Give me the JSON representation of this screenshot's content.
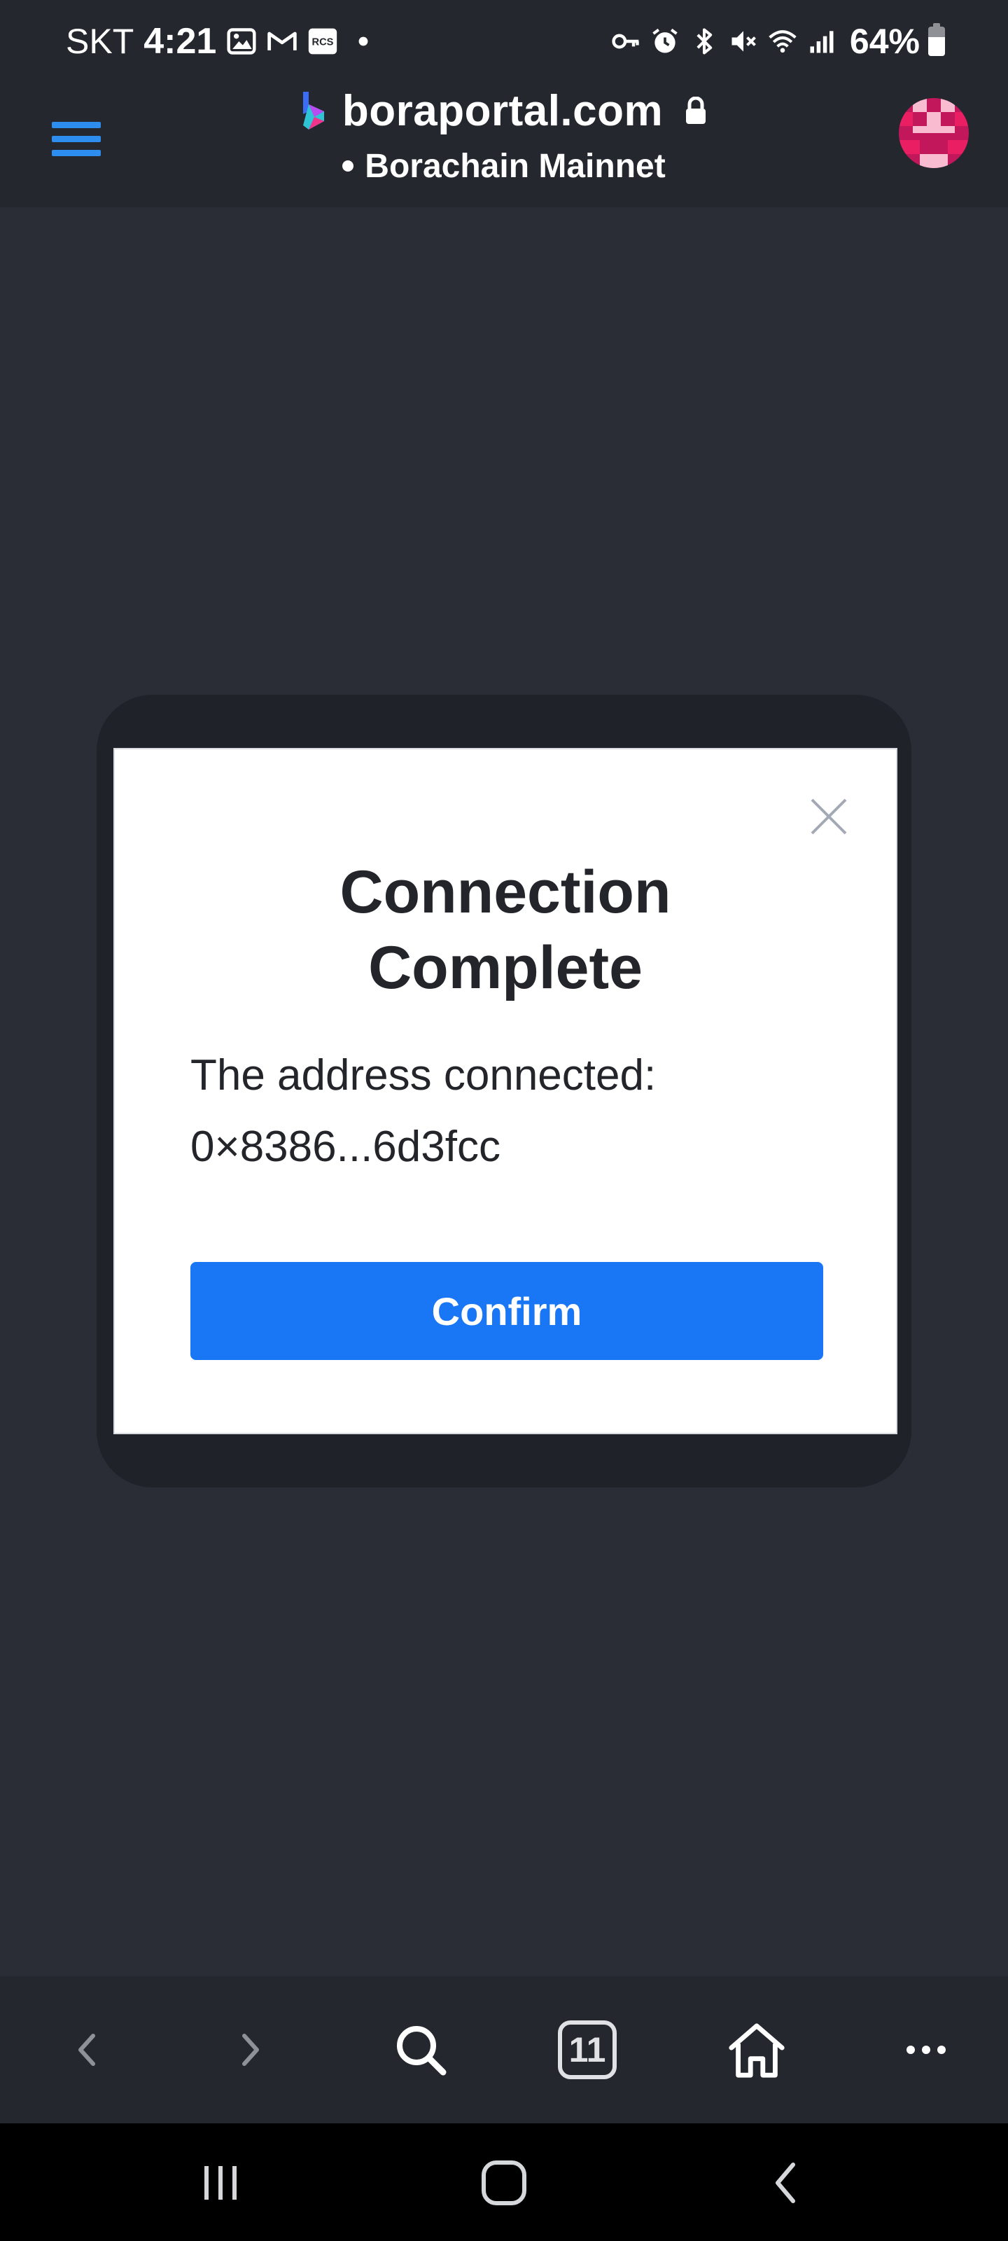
{
  "status_bar": {
    "carrier": "SKT",
    "time": "4:21",
    "battery_percent": "64%",
    "battery_level": 0.64,
    "icons_left": [
      "gallery-icon",
      "gmail-icon",
      "rcs-icon",
      "notification-dot-icon"
    ],
    "icons_right": [
      "vpn-key-icon",
      "alarm-icon",
      "bluetooth-icon",
      "mute-icon",
      "wifi-icon",
      "signal-icon",
      "battery-icon"
    ]
  },
  "header": {
    "site_domain": "boraportal.com",
    "network_name": "Borachain Mainnet",
    "accent_color": "#2e8ef0",
    "avatar_colors": [
      "#c2185b",
      "#e91e63",
      "#f8bbd0"
    ]
  },
  "modal": {
    "title_line1": "Connection",
    "title_line2": "Complete",
    "connected_label": "The address connected:",
    "connected_address": "0×8386...6d3fcc",
    "confirm_label": "Confirm",
    "button_color": "#1976f5"
  },
  "toolbar": {
    "tabs_count": "11",
    "items": [
      "back-icon",
      "forward-icon",
      "search-icon",
      "tabs-icon",
      "home-icon",
      "more-icon"
    ]
  },
  "system_nav": {
    "items": [
      "recent-apps-icon",
      "home-button-icon",
      "system-back-icon"
    ]
  }
}
